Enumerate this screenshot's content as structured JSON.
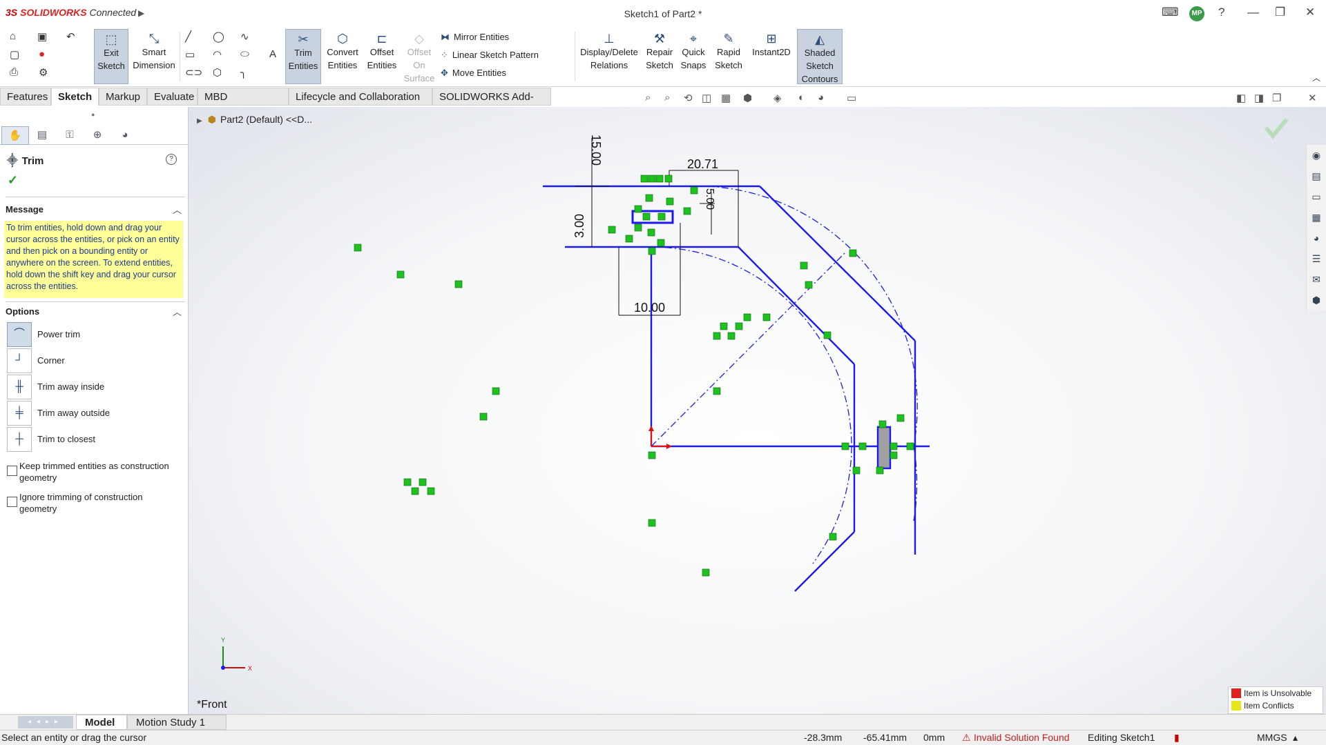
{
  "app": {
    "brand_prefix": "3S",
    "brand_name": "SOLIDWORKS",
    "brand_suffix": "Connected",
    "window_title": "Sketch1 of Part2 *",
    "user_initials": "MP"
  },
  "window_controls": {
    "terminal": "⌨",
    "help": "?",
    "minimize": "—",
    "restore": "❐",
    "close": "✕"
  },
  "toolbar": {
    "exit_sketch": "Exit Sketch",
    "smart_dimension": "Smart Dimension",
    "trim_entities": "Trim Entities",
    "convert_entities": "Convert Entities",
    "offset_entities": "Offset Entities",
    "offset_on_surface": "Offset On Surface",
    "mirror_entities": "Mirror Entities",
    "linear_sketch_pattern": "Linear Sketch Pattern",
    "move_entities": "Move Entities",
    "display_delete_relations": "Display/Delete Relations",
    "repair_sketch": "Repair Sketch",
    "quick_snaps": "Quick Snaps",
    "rapid_sketch": "Rapid Sketch",
    "instant2d": "Instant2D",
    "shaded_sketch_contours": "Shaded Sketch Contours"
  },
  "tabs": [
    "Features",
    "Sketch",
    "Markup",
    "Evaluate",
    "MBD Dimensions",
    "Lifecycle and Collaboration",
    "SOLIDWORKS Add-Ins"
  ],
  "active_tab": "Sketch",
  "property_manager": {
    "title": "Trim",
    "message_header": "Message",
    "message": "To trim entities, hold down and drag your cursor across the entities, or pick on an entity and then pick on a bounding entity or anywhere on the screen.  To extend entities, hold down the shift key and drag your cursor across the entities.",
    "options_header": "Options",
    "options": [
      {
        "label": "Power trim",
        "icon": "power-trim-icon",
        "selected": true
      },
      {
        "label": "Corner",
        "icon": "corner-icon",
        "selected": false
      },
      {
        "label": "Trim away inside",
        "icon": "trim-inside-icon",
        "selected": false
      },
      {
        "label": "Trim away outside",
        "icon": "trim-outside-icon",
        "selected": false
      },
      {
        "label": "Trim to closest",
        "icon": "trim-closest-icon",
        "selected": false
      }
    ],
    "checkbox1": "Keep trimmed entities as construction geometry",
    "checkbox2": "Ignore trimming of construction geometry"
  },
  "feature_tree": {
    "root": "Part2 (Default) <<D..."
  },
  "viewport": {
    "view_name": "*Front",
    "dims": {
      "d1": "15.00",
      "d2": "20.71",
      "d3": "3.00",
      "d4": "5.00",
      "d5": "10.00"
    },
    "axis_x": "X",
    "axis_y": "Y"
  },
  "legend": {
    "unsolvable": "Item is Unsolvable",
    "conflicts": "Item Conflicts",
    "unsolvable_color": "#e02020",
    "conflicts_color": "#e6e61a"
  },
  "bottom_tabs": [
    "Model",
    "Motion Study 1"
  ],
  "status": {
    "hint": "Select an entity or drag the cursor",
    "x": "-28.3mm",
    "y": "-65.41mm",
    "z": "0mm",
    "solution": "Invalid Solution Found",
    "mode": "Editing Sketch1",
    "units": "MMGS"
  },
  "colors": {
    "sketch_line": "#1a1aee",
    "relation_badge": "#1ec21e",
    "origin": "#dd1111"
  }
}
